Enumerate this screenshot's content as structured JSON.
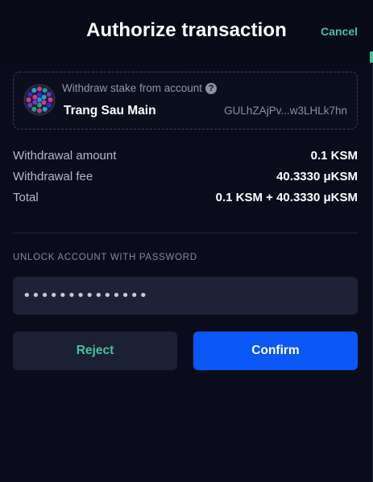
{
  "header": {
    "title": "Authorize transaction",
    "cancel_label": "Cancel"
  },
  "account": {
    "description": "Withdraw stake from account",
    "help_glyph": "?",
    "name": "Trang Sau Main",
    "address": "GULhZAjPv...w3LHLk7hn",
    "avatar_icon": "identicon-avatar"
  },
  "details": [
    {
      "label": "Withdrawal amount",
      "value": "0.1 KSM"
    },
    {
      "label": "Withdrawal fee",
      "value": "40.3330 μKSM"
    },
    {
      "label": "Total",
      "value": "0.1 KSM + 40.3330 μKSM"
    }
  ],
  "password": {
    "label": "UNLOCK ACCOUNT WITH PASSWORD",
    "value": "••••••••••••••"
  },
  "buttons": {
    "reject_label": "Reject",
    "confirm_label": "Confirm"
  },
  "colors": {
    "background": "#0a0c1b",
    "accent_green": "#42c59a",
    "confirm_blue": "#0a57f5",
    "secondary_button": "#1c2035"
  }
}
